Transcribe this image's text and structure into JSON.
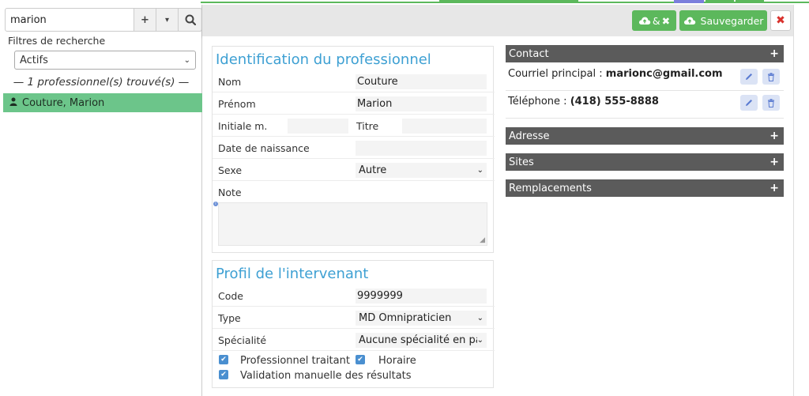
{
  "search": {
    "value": "marion",
    "add_label": "+",
    "dropdown_label": "▾",
    "search_label": "🔍"
  },
  "filters": {
    "label": "Filtres de recherche",
    "selected": "Actifs"
  },
  "results": {
    "count_text": "— 1 professionnel(s) trouvé(s) —",
    "items": [
      {
        "name": "Couture, Marion"
      }
    ]
  },
  "toolbar": {
    "save_close_label": "&",
    "save_label": "Sauvegarder",
    "close_label": "✖"
  },
  "identification": {
    "title": "Identification du professionnel",
    "nom_label": "Nom",
    "nom_value": "Couture",
    "prenom_label": "Prénom",
    "prenom_value": "Marion",
    "initiale_label": "Initiale m.",
    "initiale_value": "",
    "titre_label": "Titre",
    "titre_value": "",
    "naissance_label": "Date de naissance",
    "naissance_value": "",
    "sexe_label": "Sexe",
    "sexe_value": "Autre",
    "note_label": "Note",
    "note_value": ""
  },
  "profil": {
    "title": "Profil de l'intervenant",
    "code_label": "Code",
    "code_value": "9999999",
    "type_label": "Type",
    "type_value": "MD Omnipraticien",
    "specialite_label": "Spécialité",
    "specialite_value": "Aucune spécialité en part",
    "traitant_label": "Professionnel traitant",
    "horaire_label": "Horaire",
    "validation_label": "Validation manuelle des résultats"
  },
  "contact": {
    "header": "Contact",
    "email_label": "Courriel principal :",
    "email_value": "marionc@gmail.com",
    "phone_label": "Téléphone :",
    "phone_value": "(418) 555-8888"
  },
  "sections": {
    "adresse": "Adresse",
    "sites": "Sites",
    "remplacements": "Remplacements"
  },
  "colors": {
    "accent_green": "#5cb85c",
    "title_blue": "#3ea0d3",
    "header_dark": "#5b5b5b",
    "selected_row": "#6cc58a"
  }
}
